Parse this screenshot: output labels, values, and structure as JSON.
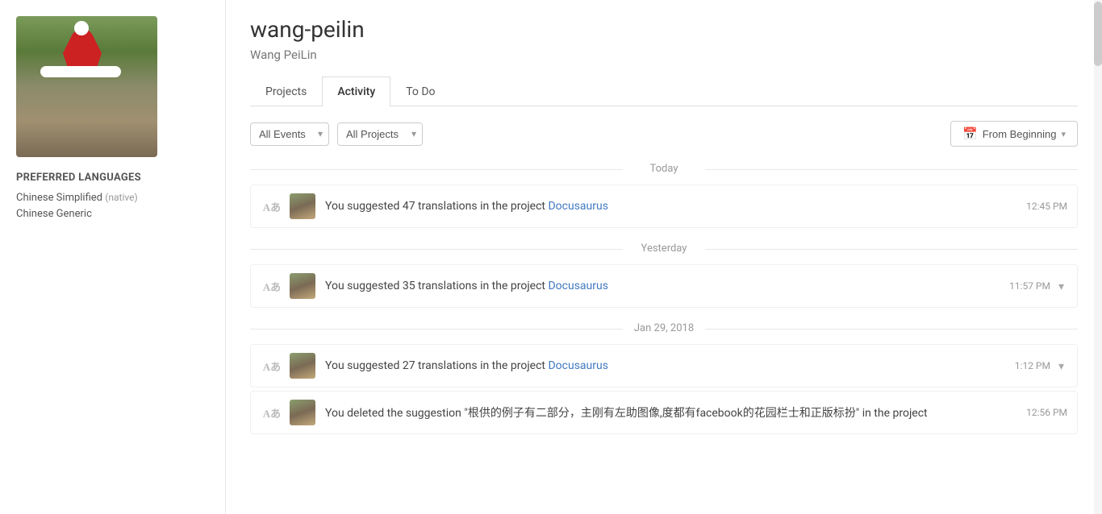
{
  "sidebar": {
    "preferred_languages_label": "Preferred Languages",
    "languages": [
      {
        "name": "Chinese Simplified",
        "note": "(native)"
      },
      {
        "name": "Chinese Generic",
        "note": ""
      }
    ]
  },
  "profile": {
    "username": "wang-peilin",
    "display_name": "Wang PeiLin"
  },
  "tabs": [
    {
      "id": "projects",
      "label": "Projects",
      "active": false
    },
    {
      "id": "activity",
      "label": "Activity",
      "active": true
    },
    {
      "id": "todo",
      "label": "To Do",
      "active": false
    }
  ],
  "filters": {
    "events_label": "All Events",
    "projects_label": "All Projects",
    "date_range_label": "From Beginning",
    "events_placeholder": "All Events",
    "projects_placeholder": "All Projects"
  },
  "activity": {
    "today_label": "Today",
    "yesterday_label": "Yesterday",
    "jan29_label": "Jan 29, 2018",
    "items": [
      {
        "id": 1,
        "group": "today",
        "text_prefix": "You suggested 47 translations in the project ",
        "project_link": "Docusaurus",
        "time": "12:45 PM",
        "expandable": false
      },
      {
        "id": 2,
        "group": "yesterday",
        "text_prefix": "You suggested 35 translations in the project ",
        "project_link": "Docusaurus",
        "time": "11:57 PM",
        "expandable": true
      },
      {
        "id": 3,
        "group": "jan29",
        "text_prefix": "You suggested 27 translations in the project ",
        "project_link": "Docusaurus",
        "time": "1:12 PM",
        "expandable": true
      },
      {
        "id": 4,
        "group": "jan29",
        "text_prefix": "You deleted the suggestion \"根供的例子有二部分，主刚有左助图像,度都有facebook的花园栏士和正版标扮\" in the project ",
        "project_link": "",
        "time": "12:56 PM",
        "expandable": false
      }
    ]
  },
  "icons": {
    "translate_icon": "Aあ",
    "calendar_icon": "📅",
    "chevron_down": "▾"
  }
}
